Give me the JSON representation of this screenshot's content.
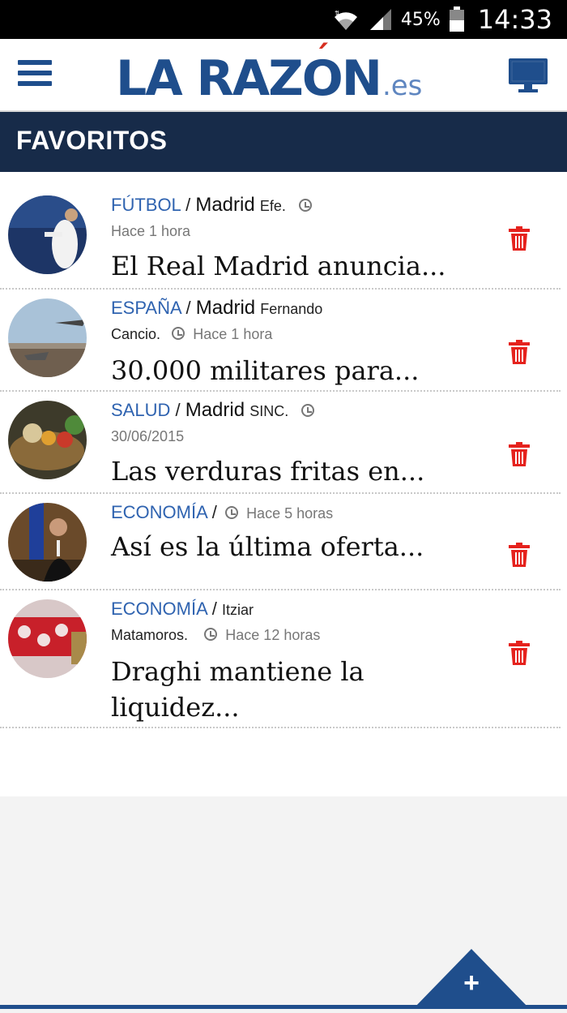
{
  "status_bar": {
    "battery_percent": "45%",
    "time": "14:33",
    "icons": [
      "wifi-icon",
      "signal-icon",
      "battery-icon"
    ]
  },
  "header": {
    "logo_main": "LA RAZÓN",
    "logo_suffix": ".es",
    "menu_icon": "hamburger-menu-icon",
    "desktop_icon": "desktop-monitor-icon"
  },
  "section": {
    "title": "FAVORITOS"
  },
  "items": [
    {
      "category": "FÚTBOL",
      "city": "Madrid",
      "author": "Efe.",
      "time": "Hace 1 hora",
      "headline": "El Real Madrid anuncia..."
    },
    {
      "category": "ESPAÑA",
      "city": "Madrid",
      "author": "Fernando",
      "author_line2": "Cancio.",
      "time": "Hace 1 hora",
      "headline": "30.000 militares para..."
    },
    {
      "category": "SALUD",
      "city": "Madrid",
      "author": "SINC.",
      "time": "30/06/2015",
      "headline": "Las verduras fritas en..."
    },
    {
      "category": "ECONOMÍA",
      "city": "",
      "author": "",
      "time": "Hace 5 horas",
      "headline": "Así es la última oferta..."
    },
    {
      "category": "ECONOMÍA",
      "city": "",
      "author": "Itziar",
      "author_line2": "Matamoros.",
      "time": "Hace 12 horas",
      "headline_line1": "Draghi mantiene la",
      "headline_line2": "liquidez..."
    }
  ],
  "colors": {
    "brand_blue": "#1f4e8c",
    "section_bar": "#172b49",
    "category_blue": "#2f63b0",
    "delete_red": "#e5221d"
  },
  "fab": {
    "label": "+",
    "icon": "plus-icon"
  }
}
